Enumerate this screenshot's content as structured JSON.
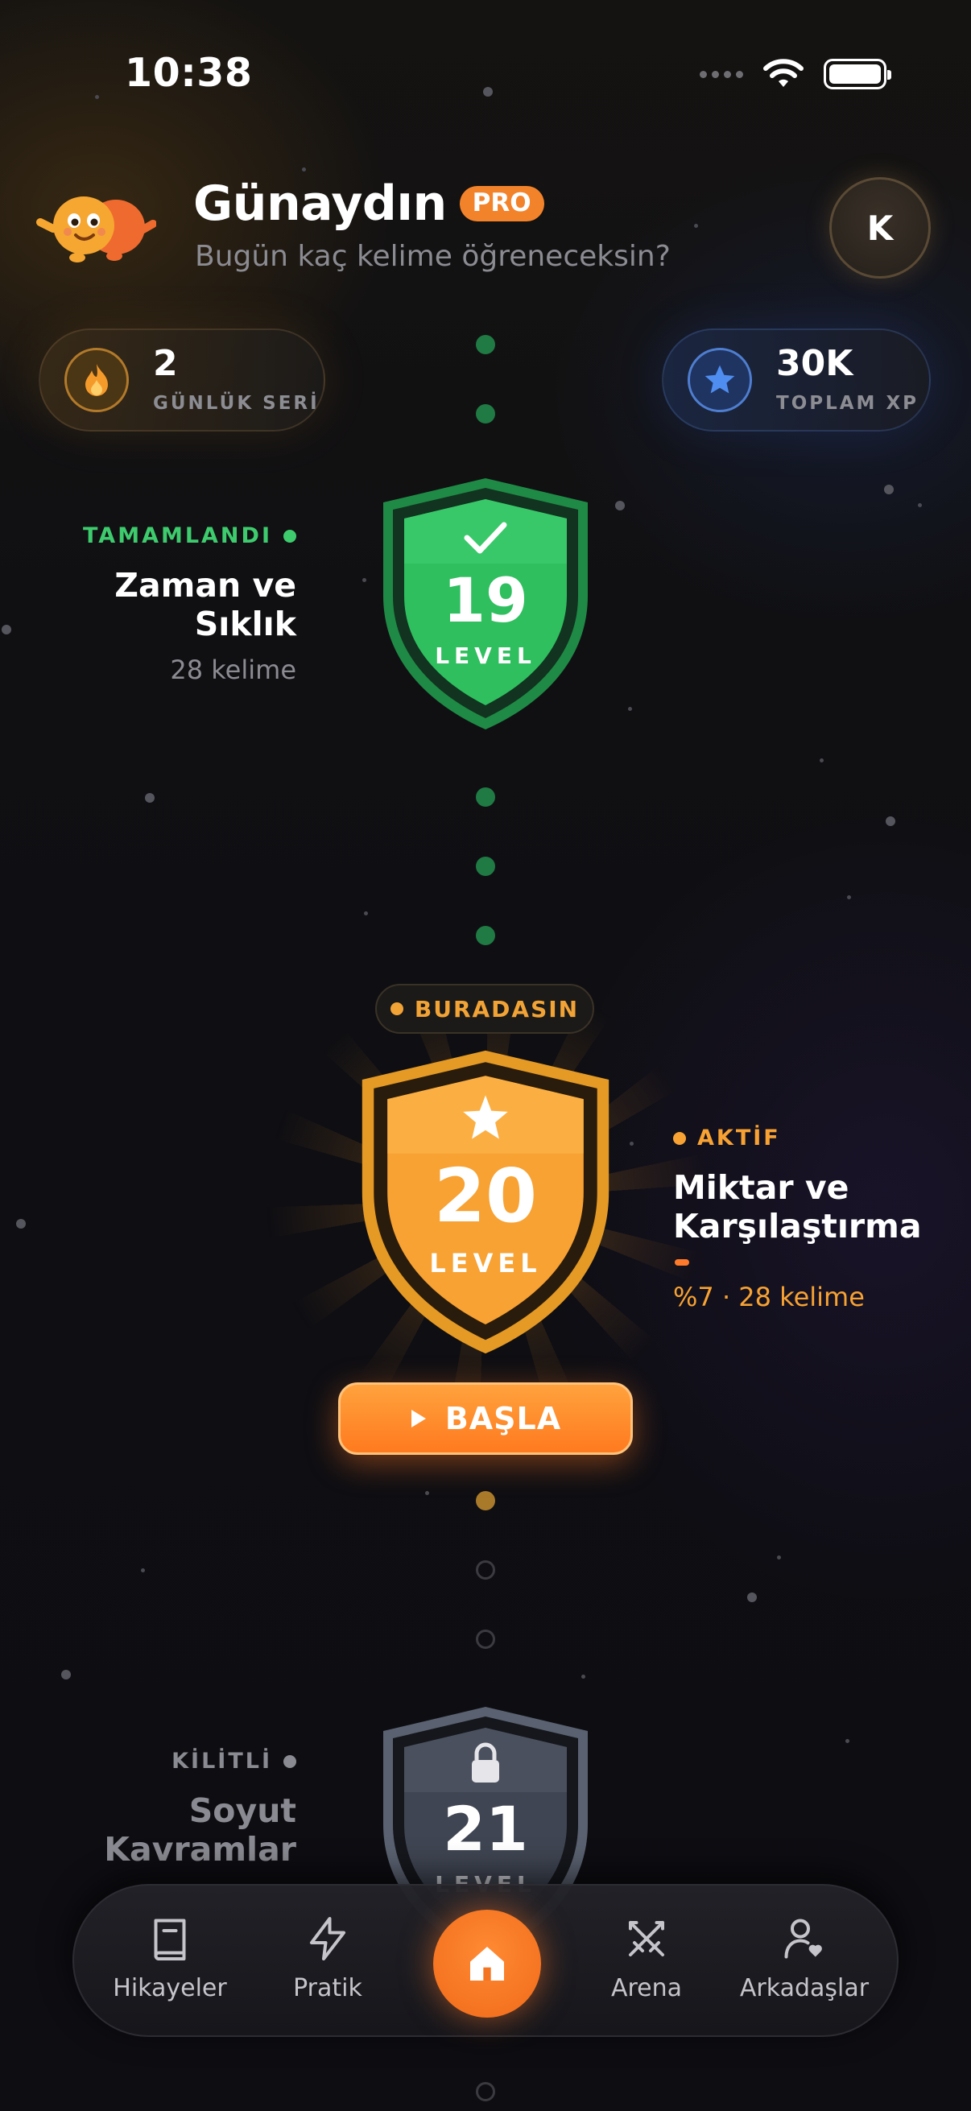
{
  "status_bar": {
    "time": "10:38"
  },
  "header": {
    "greeting": "Günaydın",
    "badge": "PRO",
    "subtitle": "Bugün kaç kelime öğreneceksin?",
    "avatar_initial": "K"
  },
  "stats": {
    "streak": {
      "value": "2",
      "label": "GÜNLÜK SERİ",
      "icon": "flame-icon"
    },
    "xp": {
      "value": "30K",
      "label": "TOPLAM XP",
      "icon": "star-icon"
    }
  },
  "levels": [
    {
      "number": "19",
      "level_label": "LEVEL",
      "status": "TAMAMLANDI",
      "title_line1": "Zaman ve",
      "title_line2": "Sıklık",
      "meta": "28 kelime",
      "state": "completed",
      "color": "#2fbf5f"
    },
    {
      "number": "20",
      "level_label": "LEVEL",
      "status": "AKTİF",
      "title_line1": "Miktar ve",
      "title_line2": "Karşılaştırma",
      "meta": "%7 · 28 kelime",
      "progress": 0.07,
      "state": "active",
      "color": "#f7a233",
      "here_label": "BURADASIN",
      "start_label": "BAŞLA"
    },
    {
      "number": "21",
      "level_label": "LEVEL",
      "status": "KİLİTLİ",
      "title_line1": "Soyut",
      "title_line2": "Kavramlar",
      "state": "locked",
      "color": "#4a5160"
    }
  ],
  "tabbar": {
    "items": [
      {
        "label": "Hikayeler",
        "icon": "book-icon"
      },
      {
        "label": "Pratik",
        "icon": "bolt-icon"
      },
      {
        "label": "",
        "icon": "home-icon",
        "active": true
      },
      {
        "label": "Arena",
        "icon": "swords-icon"
      },
      {
        "label": "Arkadaşlar",
        "icon": "friend-heart-icon"
      }
    ]
  }
}
